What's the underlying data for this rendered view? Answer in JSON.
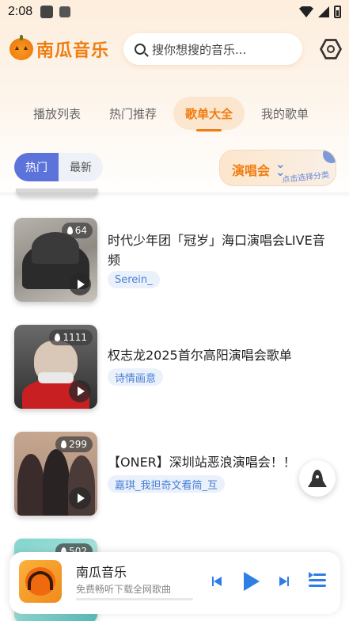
{
  "status_bar": {
    "time": "2:08"
  },
  "header": {
    "app_name": "南瓜音乐",
    "search_placeholder": "搜你想搜的音乐..."
  },
  "tabs": [
    {
      "label": "播放列表",
      "active": false
    },
    {
      "label": "热门推荐",
      "active": false
    },
    {
      "label": "歌单大全",
      "active": true
    },
    {
      "label": "我的歌单",
      "active": false
    }
  ],
  "filters": [
    {
      "label": "热门",
      "active": true
    },
    {
      "label": "最新",
      "active": false
    }
  ],
  "category": {
    "label": "演唱会",
    "hint": "点击选择分类"
  },
  "playlists": [
    {
      "hot": "64",
      "title": "时代少年团「冠岁」海口演唱会LIVE音频",
      "tag": "Serein_"
    },
    {
      "hot": "1111",
      "title": "权志龙2025首尔高阳演唱会歌单",
      "tag": "诗情画意"
    },
    {
      "hot": "299",
      "title": "【ONER】深圳站恶浪演唱会！！",
      "tag": "嘉琪_我担奇文看简_互"
    },
    {
      "hot": "502",
      "title": "",
      "tag": ""
    }
  ],
  "player": {
    "title": "南瓜音乐",
    "subtitle": "免费畅听下载全网歌曲",
    "progress": 0
  },
  "colors": {
    "brand_orange": "#ef7d11",
    "accent_blue": "#2f7ee6",
    "chip_blue": "#5b73db"
  }
}
